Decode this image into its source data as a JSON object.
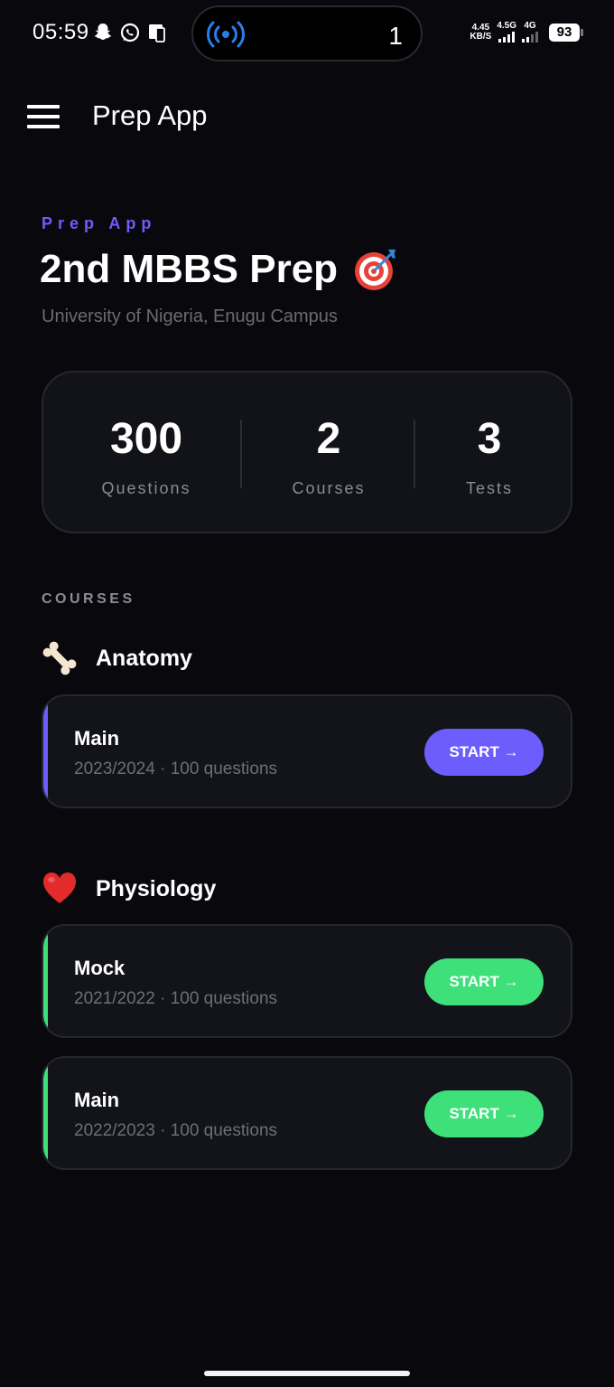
{
  "status_bar": {
    "time": "05:59",
    "island_count": "1",
    "net_speed_value": "4.45",
    "net_speed_unit": "KB/S",
    "signal1_label": "4.5G",
    "signal2_label": "4G",
    "battery": "93"
  },
  "app_bar": {
    "title": "Prep App"
  },
  "hero": {
    "eyebrow": "Prep App",
    "title": "2nd MBBS Prep",
    "subtitle": "University of Nigeria, Enugu Campus"
  },
  "stats": [
    {
      "value": "300",
      "label": "Questions"
    },
    {
      "value": "2",
      "label": "Courses"
    },
    {
      "value": "3",
      "label": "Tests"
    }
  ],
  "section_label": "COURSES",
  "courses": [
    {
      "name": "Anatomy",
      "icon": "bone-icon",
      "accent": "#6d5dfc",
      "tests": [
        {
          "title": "Main",
          "meta": "2023/2024 · 100 questions",
          "button": "START →"
        }
      ]
    },
    {
      "name": "Physiology",
      "icon": "heart-icon",
      "accent": "#3ee07a",
      "tests": [
        {
          "title": "Mock",
          "meta": "2021/2022 · 100 questions",
          "button": "START →"
        },
        {
          "title": "Main",
          "meta": "2022/2023 · 100 questions",
          "button": "START →"
        }
      ]
    }
  ],
  "colors": {
    "background": "#09090d",
    "anatomy_accent": "#6d5dfc",
    "physiology_accent": "#3ee07a",
    "anatomy_button_text": "#ffffff",
    "physiology_button_text": "#ffffff"
  }
}
